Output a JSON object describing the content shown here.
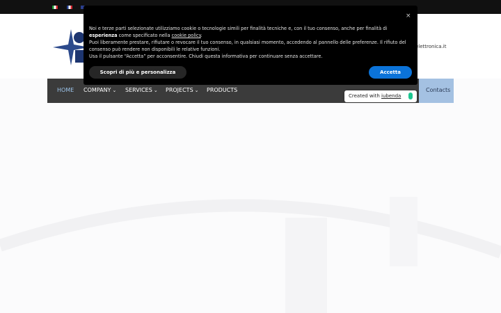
{
  "languages": [
    {
      "code": "it",
      "icon": "italy-flag-icon"
    },
    {
      "code": "fr",
      "icon": "france-flag-icon"
    },
    {
      "code": "en",
      "icon": "uk-flag-icon"
    }
  ],
  "header": {
    "logo_icon": "company-logo-icon",
    "email_fragment": "elettronica.it"
  },
  "nav": {
    "items": [
      {
        "label": "HOME",
        "active": true,
        "dropdown": false
      },
      {
        "label": "COMPANY",
        "dropdown": true
      },
      {
        "label": "SERVICES",
        "dropdown": true
      },
      {
        "label": "PROJECTS",
        "dropdown": true
      },
      {
        "label": "PRODUCTS",
        "dropdown": false
      }
    ],
    "chevron": "⌄",
    "contacts_label": "Contacts"
  },
  "cookie_banner": {
    "close_symbol": "×",
    "p1_before": "Noi e terze parti selezionate utilizziamo cookie o tecnologie simili per finalità tecniche e, con il tuo consenso, anche per finalità di ",
    "p1_bold": "esperienza",
    "p1_mid": " come specificato nella ",
    "p1_link": "cookie policy",
    "p1_after": ".",
    "p2": "Puoi liberamente prestare, rifiutare o revocare il tuo consenso, in qualsiasi momento, accedendo al pannello delle preferenze. Il rifiuto del consenso può rendere non disponibili le relative funzioni.",
    "p3": "Usa il pulsante “Accetta” per acconsentire. Chiudi questa informativa per continuare senza accettare.",
    "more_button": "Scopri di più e personalizza",
    "accept_button": "Accetta"
  },
  "iubenda": {
    "prefix": "Created with ",
    "link": "iubenda"
  },
  "colors": {
    "navbar": "#3b3b3b",
    "nav_active": "#9cc4ea",
    "contacts_bg": "#a4c1e2",
    "accept": "#0b73d9",
    "banner_bg": "#000000"
  }
}
